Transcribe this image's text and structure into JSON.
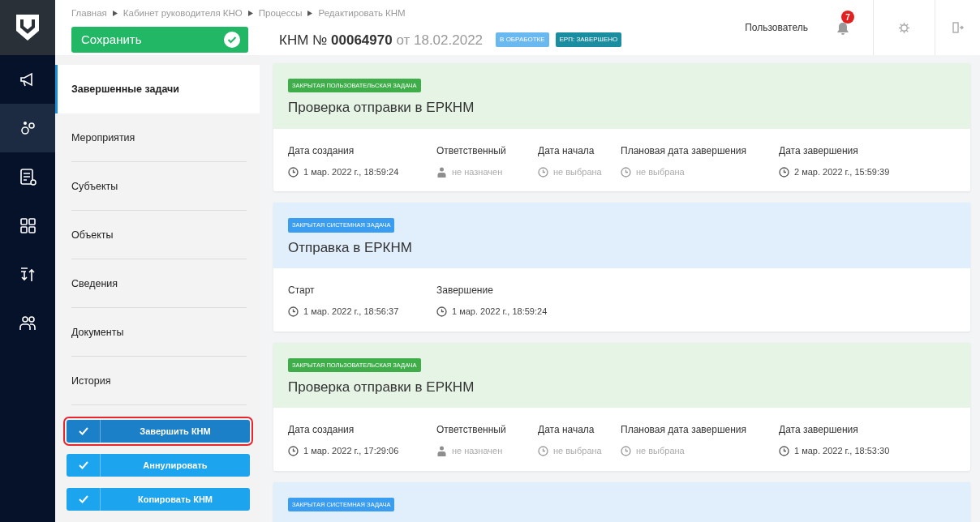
{
  "breadcrumb": [
    "Главная",
    "Кабинет руководителя КНО",
    "Процессы",
    "Редактировать КНМ"
  ],
  "save_button": {
    "label": "Сохранить"
  },
  "title": {
    "prefix": "КНМ №",
    "number": "00064970",
    "date": "от 18.02.2022"
  },
  "status_badges": [
    {
      "label": "В ОБРАБОТКЕ",
      "color": "#6ab8f0"
    },
    {
      "label": "ЕРП: ЗАВЕРШЕНО",
      "color": "#1a8ea0"
    }
  ],
  "user": {
    "name": "Пользователь",
    "notifications": "7"
  },
  "rail": [
    {
      "selected": false
    },
    {
      "selected": true
    },
    {
      "selected": false
    },
    {
      "selected": false
    },
    {
      "selected": false
    },
    {
      "selected": false
    }
  ],
  "menu": [
    {
      "label": "Завершенные задачи",
      "selected": true
    },
    {
      "label": "Мероприятия",
      "selected": false
    },
    {
      "label": "Субъекты",
      "selected": false
    },
    {
      "label": "Объекты",
      "selected": false
    },
    {
      "label": "Сведения",
      "selected": false
    },
    {
      "label": "Документы",
      "selected": false
    },
    {
      "label": "История",
      "selected": false
    }
  ],
  "actions": [
    {
      "label": "Завершить КНМ",
      "highlighted": true
    },
    {
      "label": "Аннулировать",
      "highlighted": false
    },
    {
      "label": "Копировать КНМ",
      "highlighted": false
    }
  ],
  "tasks": [
    {
      "kind": "user",
      "badge": "ЗАКРЫТАЯ ПОЛЬЗОВАТЕЛЬСКАЯ ЗАДАЧА",
      "title": "Проверка отправки в ЕРКНМ",
      "fields": [
        {
          "label": "Дата создания",
          "kind": "date",
          "value": "1 мар. 2022 г., 18:59:24",
          "muted": false
        },
        {
          "label": "Ответственный",
          "kind": "person",
          "value": "не назначен",
          "muted": true
        },
        {
          "label": "Дата начала",
          "kind": "date",
          "value": "не выбрана",
          "muted": true
        },
        {
          "label": "Плановая дата завершения",
          "kind": "date",
          "value": "не выбрана",
          "muted": true
        },
        {
          "label": "Дата завершения",
          "kind": "date",
          "value": "2 мар. 2022 г., 15:59:39",
          "muted": false
        }
      ]
    },
    {
      "kind": "system",
      "badge": "ЗАКРЫТАЯ СИСТЕМНАЯ ЗАДАЧА",
      "title": "Отправка в ЕРКНМ",
      "fields": [
        {
          "label": "Старт",
          "kind": "date",
          "value": "1 мар. 2022 г., 18:56:37",
          "muted": false
        },
        {
          "label": "Завершение",
          "kind": "date",
          "value": "1 мар. 2022 г., 18:59:24",
          "muted": false
        }
      ]
    },
    {
      "kind": "user",
      "badge": "ЗАКРЫТАЯ ПОЛЬЗОВАТЕЛЬСКАЯ ЗАДАЧА",
      "title": "Проверка отправки в ЕРКНМ",
      "fields": [
        {
          "label": "Дата создания",
          "kind": "date",
          "value": "1 мар. 2022 г., 17:29:06",
          "muted": false
        },
        {
          "label": "Ответственный",
          "kind": "person",
          "value": "не назначен",
          "muted": true
        },
        {
          "label": "Дата начала",
          "kind": "date",
          "value": "не выбрана",
          "muted": true
        },
        {
          "label": "Плановая дата завершения",
          "kind": "date",
          "value": "не выбрана",
          "muted": true
        },
        {
          "label": "Дата завершения",
          "kind": "date",
          "value": "1 мар. 2022 г., 18:53:30",
          "muted": false
        }
      ]
    },
    {
      "kind": "system",
      "badge": "ЗАКРЫТАЯ СИСТЕМНАЯ ЗАДАЧА"
    }
  ]
}
